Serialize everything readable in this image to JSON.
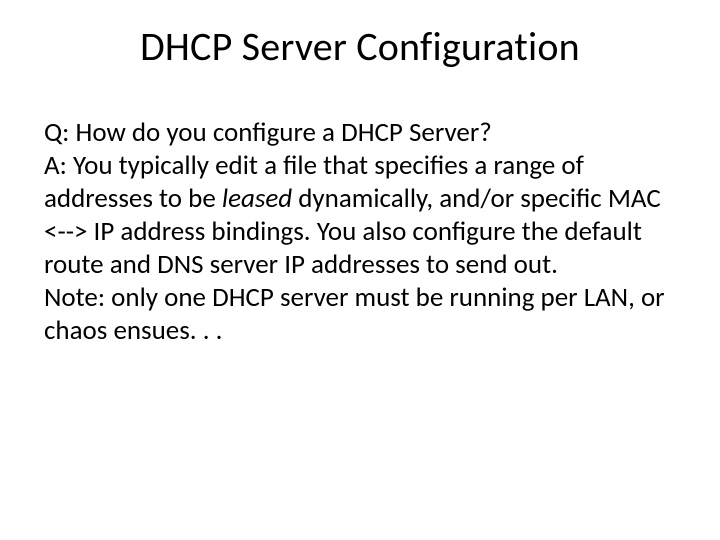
{
  "slide": {
    "title": "DHCP Server Configuration",
    "question": "Q: How do you configure a DHCP Server?",
    "answer_pre": "A: You typically edit a file that specifies a range of addresses to be ",
    "answer_leased": "leased",
    "answer_post": " dynamically, and/or specific MAC <--> IP address bindings.  You also configure the default route and DNS server IP addresses to send out.",
    "note": "Note: only one DHCP server must be running per LAN, or chaos ensues. . ."
  }
}
